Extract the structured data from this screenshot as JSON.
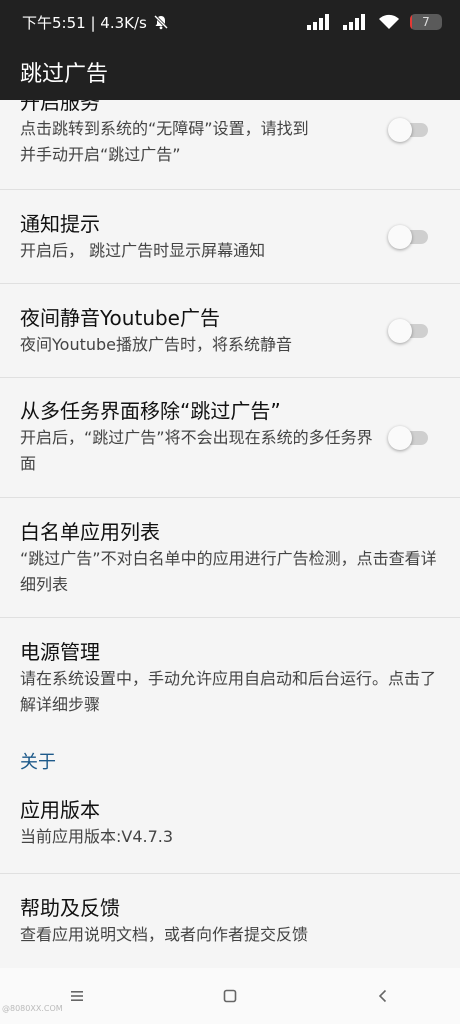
{
  "status_bar": {
    "time_speed": "下午5:51 | 4.3K/s",
    "battery_level": "7",
    "battery_percent": 7
  },
  "app_bar": {
    "title": "跳过广告"
  },
  "prefs": {
    "accessibility": {
      "title": "开启服务",
      "summary": "点击跳转到系统的“无障碍”设置，请找到并手动开启“跳过广告”",
      "enabled": false
    },
    "notification": {
      "title": "通知提示",
      "summary": "开启后， 跳过广告时显示屏幕通知",
      "enabled": false
    },
    "youtube_mute": {
      "title": "夜间静音Youtube广告",
      "summary": "夜间Youtube播放广告时，将系统静音",
      "enabled": false
    },
    "remove_recents": {
      "title": "从多任务界面移除“跳过广告”",
      "summary": "开启后，“跳过广告”将不会出现在系统的多任务界面",
      "enabled": false
    },
    "whitelist": {
      "title": "白名单应用列表",
      "summary": "“跳过广告”不对白名单中的应用进行广告检测，点击查看详细列表"
    },
    "power": {
      "title": "电源管理",
      "summary": "请在系统设置中，手动允许应用自启动和后台运行。点击了解详细步骤"
    }
  },
  "about": {
    "header": "关于",
    "version": {
      "title": "应用版本",
      "summary": "当前应用版本:V4.7.3"
    },
    "help": {
      "title": "帮助及反馈",
      "summary": "查看应用说明文档，或者向作者提交反馈"
    }
  },
  "watermark": "@8080XX.COM",
  "colors": {
    "app_bar": "#212121",
    "background": "#f5f5f5",
    "category": "#1e5a8a",
    "battery_low": "#e53935"
  },
  "icons": {
    "silent": "bell-off-icon",
    "signal": "signal-icon",
    "wifi": "wifi-icon",
    "nav_menu": "menu-icon",
    "nav_home": "home-square-icon",
    "nav_back": "back-chevron-icon"
  }
}
